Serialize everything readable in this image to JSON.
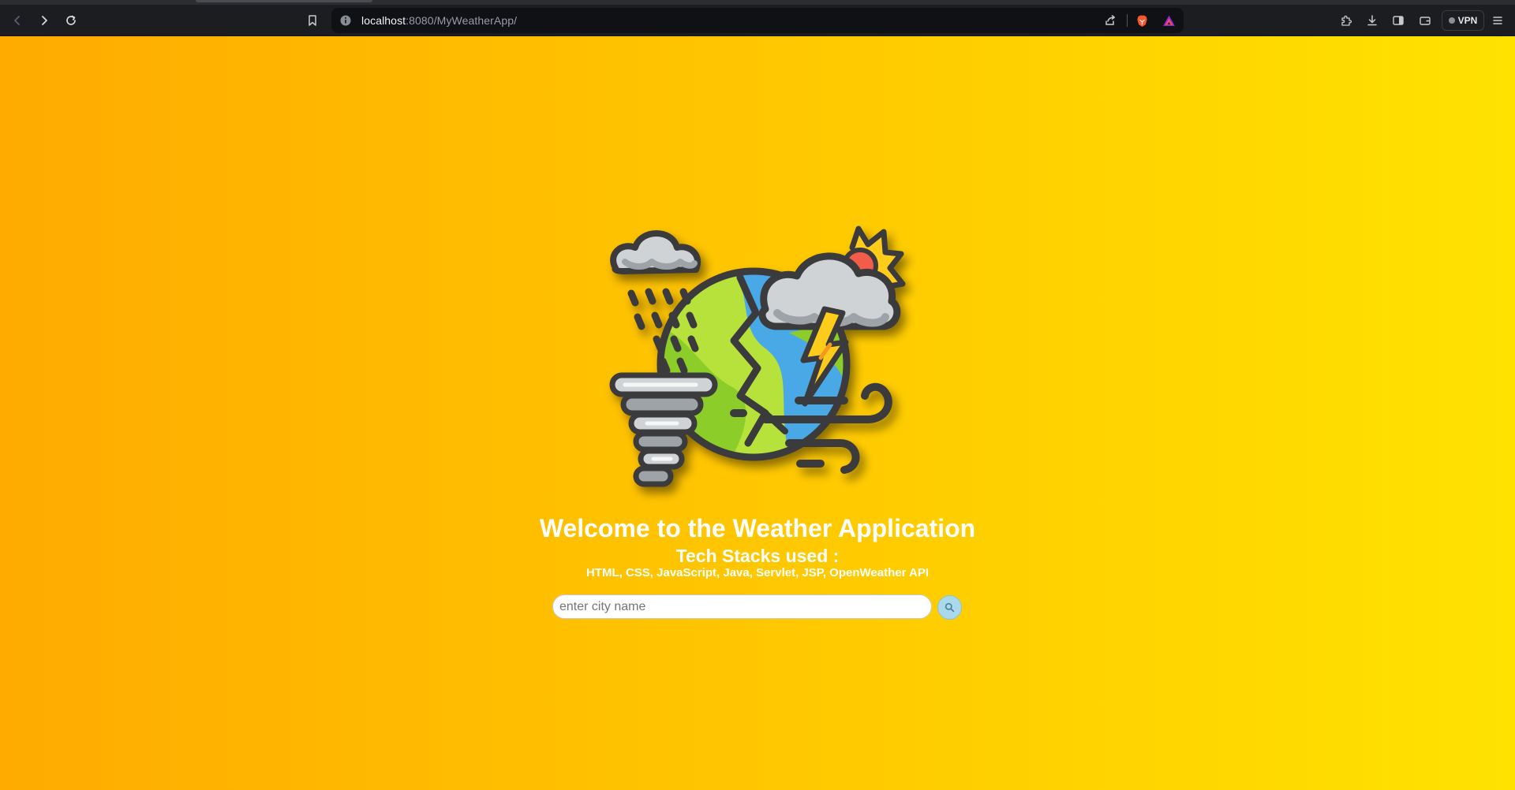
{
  "browser": {
    "url_host": "localhost",
    "url_path": ":8080/MyWeatherApp/",
    "vpn_label": "VPN",
    "icons": {
      "back": "chevron-left-icon",
      "forward": "chevron-right-icon",
      "reload": "reload-icon",
      "bookmark": "bookmark-icon",
      "site_info": "info-icon",
      "share": "share-icon",
      "brave_shields": "brave-lion-icon",
      "rewards": "rewards-triangle-icon",
      "extensions": "puzzle-icon",
      "downloads": "download-icon",
      "sidebar": "sidebar-icon",
      "wallet": "wallet-icon",
      "menu": "hamburger-menu-icon"
    }
  },
  "app": {
    "title": "Welcome to the Weather Application",
    "subtitle": "Tech Stacks used :",
    "tech_stack": "HTML, CSS, JavaScript, Java, Servlet, JSP, OpenWeather API",
    "search": {
      "placeholder": "enter city name",
      "value": ""
    },
    "hero_icon": "weather-globe-icon",
    "colors": {
      "gradient_start": "#ffab00",
      "gradient_end": "#ffe200",
      "text": "#ffffff",
      "search_button": "#a9d9ea"
    }
  }
}
